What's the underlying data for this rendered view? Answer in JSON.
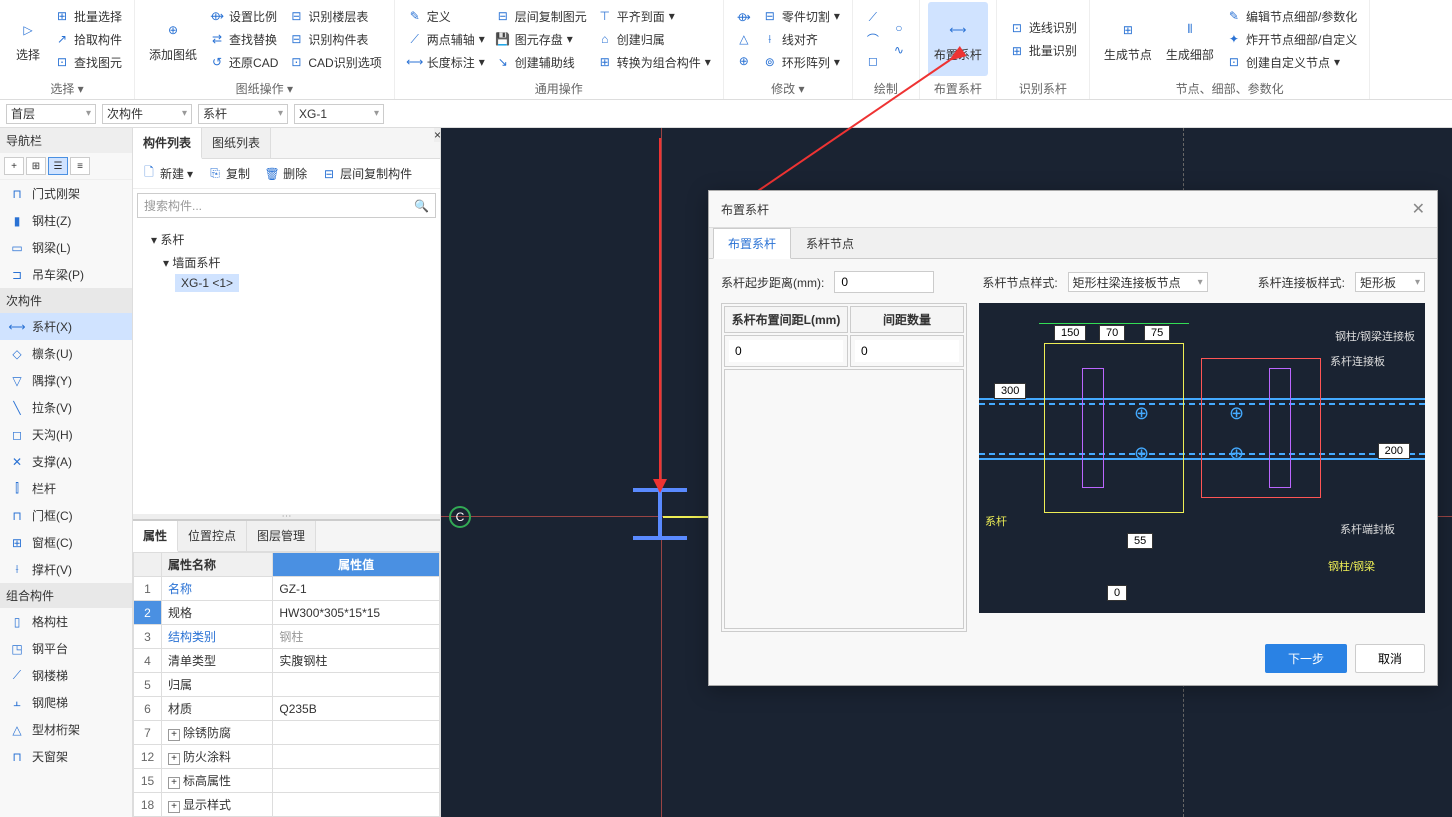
{
  "ribbon": {
    "group1": {
      "select": "选择",
      "batch_select": "批量选择",
      "pick": "拾取构件",
      "find": "查找图元",
      "title": "选择"
    },
    "group2": {
      "add": "添加图纸",
      "scale": "设置比例",
      "floor": "识别楼层表",
      "findrep": "查找替换",
      "member": "识别构件表",
      "revert": "还原CAD",
      "cad_opt": "CAD识别选项",
      "title": "图纸操作"
    },
    "group3": {
      "define": "定义",
      "twopoint": "两点辅轴",
      "length": "长度标注",
      "layercopy": "层间复制图元",
      "save": "图元存盘",
      "aux": "创建辅助线",
      "align": "平齐到面",
      "home": "创建归属",
      "combine": "转换为组合构件",
      "title": "通用操作"
    },
    "group4": {
      "partcut": "零件切割",
      "linealign": "线对齐",
      "circ": "环形阵列",
      "title": "修改"
    },
    "group5": {
      "title": "绘制"
    },
    "group6": {
      "label": "布置系杆",
      "title": "布置系杆"
    },
    "group7": {
      "line_rec": "选线识别",
      "batch_rec": "批量识别",
      "title": "识别系杆"
    },
    "group8": {
      "gen_node": "生成节点",
      "gen_detail": "生成细部",
      "edit": "编辑节点细部/参数化",
      "explode": "炸开节点细部/自定义",
      "create": "创建自定义节点",
      "title": "节点、细部、参数化"
    }
  },
  "toolbar2": {
    "floor": "首层",
    "sub": "次构件",
    "type": "系杆",
    "name": "XG-1"
  },
  "sidebar": {
    "title": "导航栏",
    "sections": [
      {
        "header": "",
        "items": [
          {
            "ico": "⊓",
            "txt": "门式刚架"
          },
          {
            "ico": "▮",
            "txt": "钢柱(Z)"
          },
          {
            "ico": "▭",
            "txt": "钢梁(L)"
          },
          {
            "ico": "⊐",
            "txt": "吊车梁(P)"
          }
        ]
      },
      {
        "header": "次构件",
        "items": [
          {
            "ico": "⟷",
            "txt": "系杆(X)",
            "sel": true
          },
          {
            "ico": "◇",
            "txt": "檩条(U)"
          },
          {
            "ico": "▽",
            "txt": "隅撑(Y)"
          },
          {
            "ico": "╲",
            "txt": "拉条(V)"
          },
          {
            "ico": "◻",
            "txt": "天沟(H)"
          },
          {
            "ico": "✕",
            "txt": "支撑(A)"
          },
          {
            "ico": "⫿",
            "txt": "栏杆"
          },
          {
            "ico": "⊓",
            "txt": "门框(C)"
          },
          {
            "ico": "⊞",
            "txt": "窗框(C)"
          },
          {
            "ico": "⟊",
            "txt": "撑杆(V)"
          }
        ]
      },
      {
        "header": "组合构件",
        "items": [
          {
            "ico": "▯",
            "txt": "格构柱"
          },
          {
            "ico": "◳",
            "txt": "钢平台"
          },
          {
            "ico": "⟋",
            "txt": "钢楼梯"
          },
          {
            "ico": "⫠",
            "txt": "钢爬梯"
          },
          {
            "ico": "△",
            "txt": "型材桁架"
          },
          {
            "ico": "⊓",
            "txt": "天窗架"
          }
        ]
      }
    ]
  },
  "mid": {
    "tabs": [
      "构件列表",
      "图纸列表"
    ],
    "toolbar": {
      "new": "新建",
      "copy": "复制",
      "delete": "删除",
      "layercopy": "层间复制构件"
    },
    "search_ph": "搜索构件...",
    "tree": {
      "root": "系杆",
      "sub": "墙面系杆",
      "leaf": "XG-1  <1>"
    },
    "prop_tabs": [
      "属性",
      "位置控点",
      "图层管理"
    ],
    "prop_headers": {
      "name": "属性名称",
      "value": "属性值"
    },
    "props": [
      {
        "n": "1",
        "name": "名称",
        "val": "GZ-1",
        "link": true
      },
      {
        "n": "2",
        "name": "规格",
        "val": "HW300*305*15*15",
        "sel": true
      },
      {
        "n": "3",
        "name": "结构类别",
        "val": "钢柱",
        "link": true,
        "gray": true
      },
      {
        "n": "4",
        "name": "清单类型",
        "val": "实腹钢柱"
      },
      {
        "n": "5",
        "name": "归属",
        "val": ""
      },
      {
        "n": "6",
        "name": "材质",
        "val": "Q235B"
      },
      {
        "n": "7",
        "name": "除锈防腐",
        "val": "",
        "exp": true
      },
      {
        "n": "12",
        "name": "防火涂料",
        "val": "",
        "exp": true
      },
      {
        "n": "15",
        "name": "标高属性",
        "val": "",
        "exp": true
      },
      {
        "n": "18",
        "name": "显示样式",
        "val": "",
        "exp": true
      }
    ]
  },
  "canvas": {
    "marker": "C"
  },
  "dialog": {
    "title": "布置系杆",
    "tabs": [
      "布置系杆",
      "系杆节点"
    ],
    "start_label": "系杆起步距离(mm):",
    "start_val": "0",
    "node_style_label": "系杆节点样式:",
    "node_style_val": "矩形柱梁连接板节点",
    "plate_style_label": "系杆连接板样式:",
    "plate_style_val": "矩形板",
    "table_h1": "系杆布置间距L(mm)",
    "table_h2": "间距数量",
    "row_v1": "0",
    "row_v2": "0",
    "diag": {
      "v150": "150",
      "v70": "70",
      "v75": "75",
      "v300": "300",
      "v200": "200",
      "v55": "55",
      "v0": "0",
      "l1": "钢柱/钢梁连接板",
      "l2": "系杆连接板",
      "l3": "系杆",
      "l4": "系杆端封板",
      "l5": "钢柱/钢梁"
    },
    "next": "下一步",
    "cancel": "取消"
  }
}
